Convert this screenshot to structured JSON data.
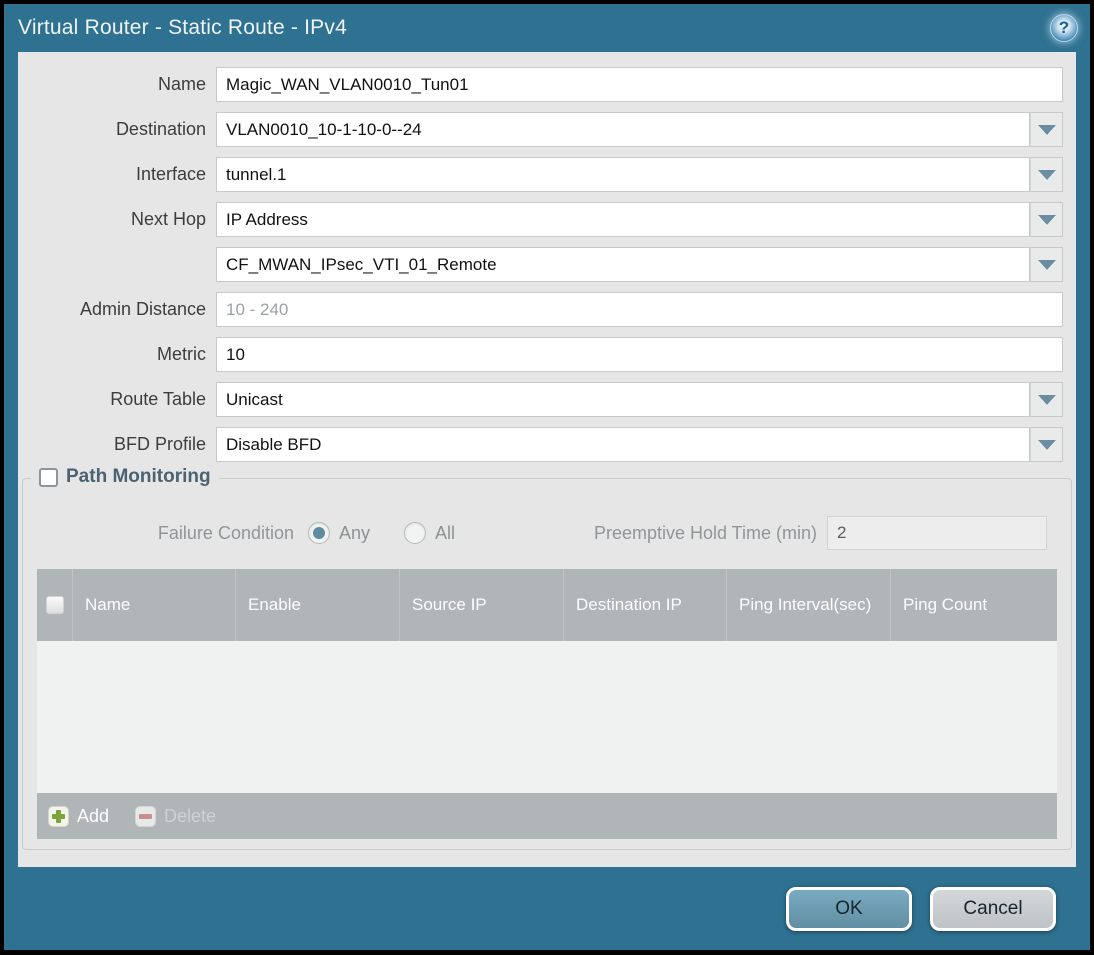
{
  "window": {
    "title": "Virtual Router - Static Route - IPv4",
    "help_icon": "?"
  },
  "form": {
    "fields": [
      {
        "label": "Name",
        "value": "Magic_WAN_VLAN0010_Tun01",
        "type": "text"
      },
      {
        "label": "Destination",
        "value": "VLAN0010_10-1-10-0--24",
        "type": "dropdown"
      },
      {
        "label": "Interface",
        "value": "tunnel.1",
        "type": "dropdown"
      },
      {
        "label": "Next Hop",
        "value": "IP Address",
        "type": "dropdown"
      },
      {
        "label": "",
        "value": "CF_MWAN_IPsec_VTI_01_Remote",
        "type": "dropdown"
      },
      {
        "label": "Admin Distance",
        "value": "",
        "placeholder": "10 - 240",
        "type": "text"
      },
      {
        "label": "Metric",
        "value": "10",
        "type": "text"
      },
      {
        "label": "Route Table",
        "value": "Unicast",
        "type": "dropdown"
      },
      {
        "label": "BFD Profile",
        "value": "Disable BFD",
        "type": "dropdown"
      }
    ]
  },
  "path_monitoring": {
    "title": "Path Monitoring",
    "checked": false,
    "failure_condition_label": "Failure Condition",
    "options": [
      {
        "label": "Any",
        "selected": true
      },
      {
        "label": "All",
        "selected": false
      }
    ],
    "hold_time_label": "Preemptive Hold Time (min)",
    "hold_time_value": "2",
    "table": {
      "columns": [
        "Name",
        "Enable",
        "Source IP",
        "Destination IP",
        "Ping Interval(sec)",
        "Ping Count"
      ],
      "rows": []
    },
    "add_label": "Add",
    "delete_label": "Delete"
  },
  "footer": {
    "ok_label": "OK",
    "cancel_label": "Cancel"
  },
  "colors": {
    "frame_teal": "#2f7190",
    "content_bg": "#e6e6e6",
    "table_gray": "#b0b5b8",
    "ok_blue": "#6ca3b9",
    "accent_green": "#7ea33b"
  }
}
